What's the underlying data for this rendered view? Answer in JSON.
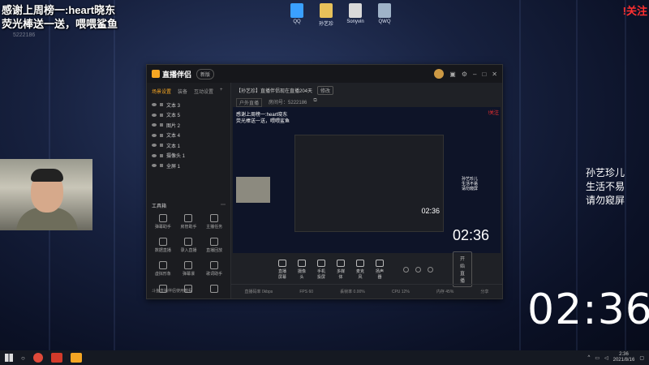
{
  "overlay": {
    "message_line1": "感谢上周榜一:heart晓东",
    "message_line2": "荧光棒送一送，喂喂鲨鱼",
    "follow_label": "!关注",
    "room_id": "5222186"
  },
  "desktop_icons": [
    {
      "label": "QQ",
      "icon": "qq-icon",
      "color": "#3aa0ff"
    },
    {
      "label": "孙艺珍",
      "icon": "folder-icon",
      "color": "#e7c15a"
    },
    {
      "label": "Sonyvin",
      "icon": "doc-icon",
      "color": "#d9d9d9"
    },
    {
      "label": "QWQ",
      "icon": "trash-icon",
      "color": "#9fb3c8"
    }
  ],
  "right_overlay": {
    "name": "孙艺珍儿",
    "line1": "生活不易",
    "line2": "请勿窥屏",
    "clock": "02:36"
  },
  "app": {
    "name": "直播伴侣",
    "version": "新版",
    "sidebar_tabs": [
      "场景设置",
      "装备",
      "互动设置"
    ],
    "scenes": [
      "文本 3",
      "文本 5",
      "图片 2",
      "文本 4",
      "文本 1",
      "摄像头 1",
      "全屏 1"
    ],
    "tools_title": "工具箱",
    "tools": [
      {
        "label": "弹幕助手",
        "icon": "danmaku-icon"
      },
      {
        "label": "房管助手",
        "icon": "admin-icon"
      },
      {
        "label": "主播任务",
        "icon": "task-icon"
      },
      {
        "label": "数据直播",
        "icon": "data-icon"
      },
      {
        "label": "录入直播",
        "icon": "record-icon"
      },
      {
        "label": "直播回放",
        "icon": "replay-icon"
      },
      {
        "label": "虚拟形象",
        "icon": "avatar-icon"
      },
      {
        "label": "弹幕瀑",
        "icon": "waterfall-icon"
      },
      {
        "label": "歌词助手",
        "icon": "lyrics-icon"
      },
      {
        "label": "",
        "icon": "game-icon"
      },
      {
        "label": "",
        "icon": "controller-icon"
      },
      {
        "label": "",
        "icon": "more-icon"
      }
    ],
    "sidebar_footer": "斗鱼直播伴侣使用教程",
    "stream_title": "【孙艺珍】直播伴侣现在直播204天",
    "stream_edit": "修改",
    "stream_category": "户外直播",
    "room_label": "房间号：5222186",
    "preview": {
      "text_line1": "感谢上周榜一:heart晓东",
      "text_line2": "荧光棒送一送，喂喂鲨鱼",
      "side_name": "孙艺珍儿",
      "side_line1": "生活不易",
      "side_line2": "请勿窥屏",
      "inner_clock": "02:36",
      "clock": "02:36",
      "follow": "!关注"
    },
    "bottom_actions": [
      {
        "label": "直播屏幕",
        "icon": "screen-icon"
      },
      {
        "label": "摄像头",
        "icon": "camera-icon"
      },
      {
        "label": "手机投屏",
        "icon": "phone-icon"
      },
      {
        "label": "多媒体",
        "icon": "media-icon"
      },
      {
        "label": "麦克风",
        "icon": "mic-icon"
      },
      {
        "label": "扬声器",
        "icon": "speaker-icon"
      }
    ],
    "start_button": "开始直播",
    "status_items": [
      "直播码率 0kbps",
      "FPS 60",
      "丢帧率 0.00%",
      "CPU 12%",
      "内存 45%",
      "分享"
    ]
  },
  "taskbar": {
    "apps": [
      {
        "icon": "chrome-icon",
        "color": "#e04a3a"
      },
      {
        "icon": "douyu-icon",
        "color": "#d23a2a"
      },
      {
        "icon": "companion-icon",
        "color": "#f5a623"
      }
    ],
    "time": "2:36",
    "date": "2021/8/16"
  }
}
